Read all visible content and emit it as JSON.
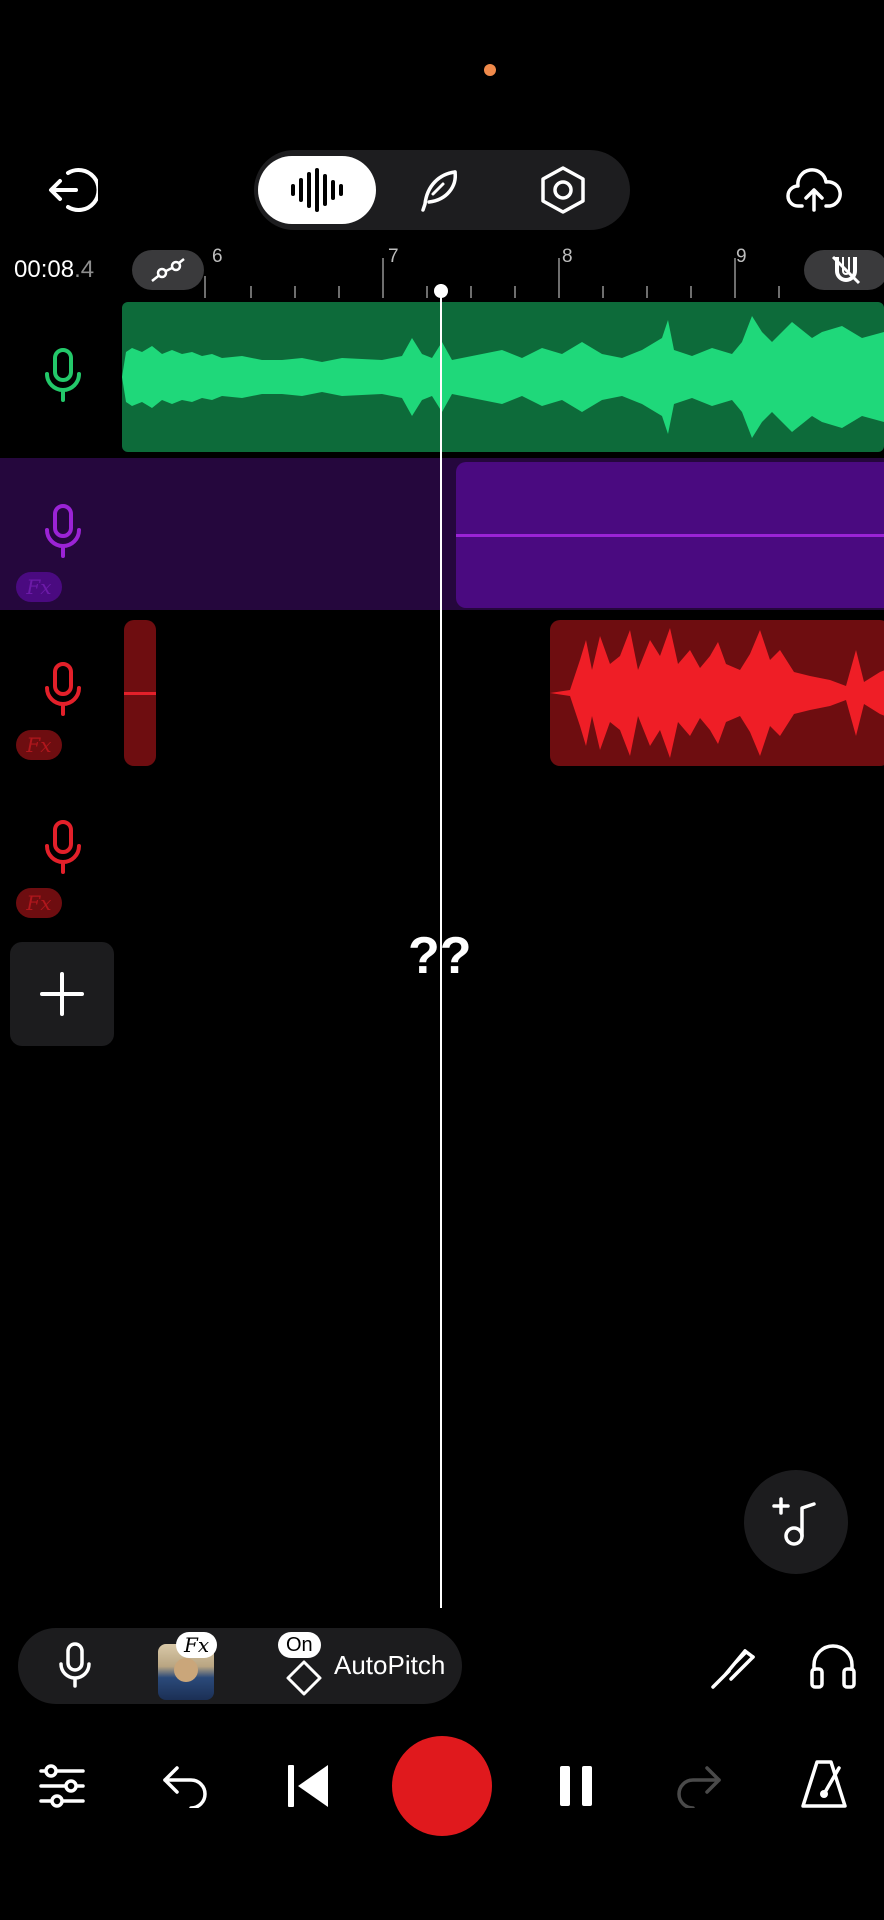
{
  "status": {
    "indicator_color": "#f08a4b"
  },
  "header": {
    "exit_icon": "exit-icon",
    "modes": [
      {
        "name": "waveform",
        "icon": "waveform-icon",
        "active": true
      },
      {
        "name": "quill",
        "icon": "quill-icon",
        "active": false
      },
      {
        "name": "settings",
        "icon": "hex-nut-icon",
        "active": false
      }
    ],
    "upload_icon": "cloud-upload-icon"
  },
  "timeline": {
    "timecode_main": "00:08",
    "timecode_frac": ".4",
    "ruler_labels": [
      "6",
      "7",
      "8",
      "9"
    ],
    "automation_icon": "automation-curve-icon",
    "snap_icon": "magnet-off-icon"
  },
  "tracks": [
    {
      "color": "#23c86a",
      "clip_bg": "#0d6b3a",
      "fx": false
    },
    {
      "color": "#9b23d6",
      "clip_bg": "#4a0a80",
      "fx": true,
      "fx_label": "Fx"
    },
    {
      "color": "#e3202a",
      "clip_bg": "#6e0d10",
      "fx": true,
      "fx_label": "Fx"
    },
    {
      "color": "#e3202a",
      "fx": true,
      "fx_label": "Fx"
    }
  ],
  "center_label": "??",
  "bottom_toolbar": {
    "fx_badge": "Fx",
    "on_badge": "On",
    "autopitch_label": "AutoPitch"
  },
  "transport": {
    "mixer_icon": "sliders-icon",
    "undo_icon": "undo-icon",
    "skip_back_icon": "skip-to-start-icon",
    "record_color": "#e0191d",
    "pause_icon": "pause-icon",
    "redo_icon": "redo-icon",
    "metronome_icon": "metronome-icon"
  }
}
